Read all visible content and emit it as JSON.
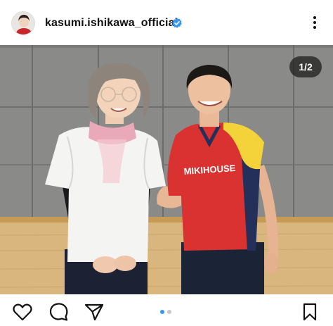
{
  "post": {
    "username": "kasumi.ishikawa_official",
    "verified": true,
    "image_counter": "1/2",
    "current_slide": 1,
    "total_slides": 2
  },
  "photo": {
    "shirt_text": "MIKIHOUSE"
  },
  "colors": {
    "verified_badge": "#3897f0",
    "active_dot": "#3897f0",
    "inactive_dot": "#c7c7c7"
  },
  "icons": {
    "more": "more-vertical-icon",
    "like": "heart-icon",
    "comment": "comment-icon",
    "share": "send-icon",
    "save": "bookmark-icon",
    "verified": "verified-badge-icon"
  }
}
